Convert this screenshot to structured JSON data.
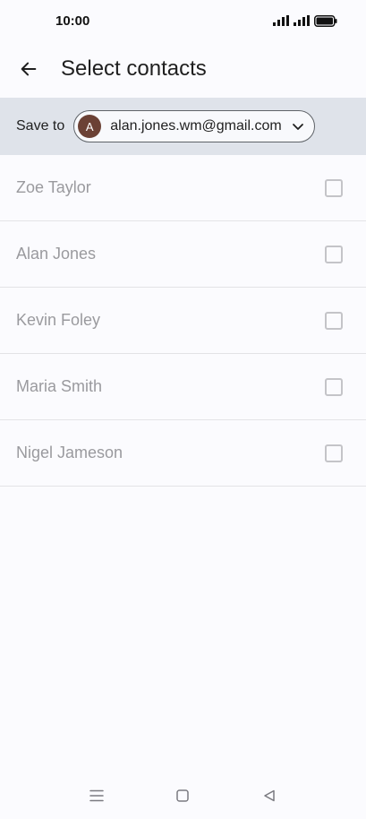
{
  "status_bar": {
    "time": "10:00",
    "icons": [
      "signal-icon",
      "signal-icon",
      "battery-icon"
    ]
  },
  "app_bar": {
    "back_icon": "arrow-left-icon",
    "title": "Select contacts"
  },
  "save_to": {
    "label": "Save to",
    "avatar_initial": "A",
    "avatar_color": "#6b4135",
    "account": "alan.jones.wm@gmail.com",
    "dropdown_icon": "chevron-down-icon"
  },
  "contacts": [
    {
      "name": "Zoe Taylor",
      "checked": false
    },
    {
      "name": "Alan Jones",
      "checked": false
    },
    {
      "name": "Kevin Foley",
      "checked": false
    },
    {
      "name": "Maria Smith",
      "checked": false
    },
    {
      "name": "Nigel Jameson",
      "checked": false
    }
  ],
  "nav_bar": {
    "icons": [
      "menu-icon",
      "home-icon",
      "back-triangle-icon"
    ]
  },
  "colors": {
    "save_bar_bg": "#dfe3ea",
    "background": "#fbfbfe"
  }
}
